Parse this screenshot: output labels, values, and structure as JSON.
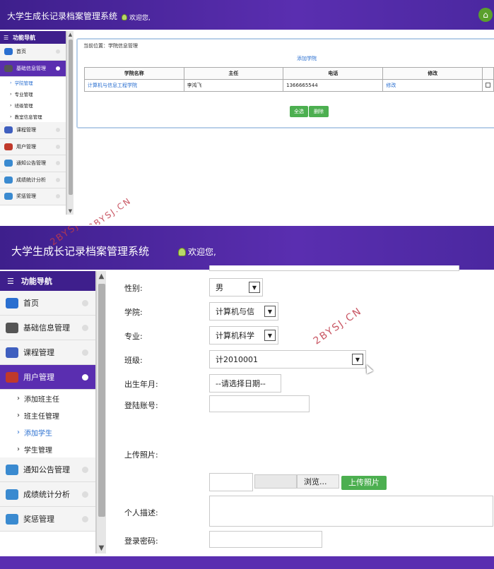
{
  "app": {
    "title": "大学生成长记录档案管理系统",
    "welcome": "欢迎您,",
    "nav_header": "功能导航"
  },
  "top": {
    "nav": [
      {
        "label": "首页",
        "icon": "monitor-icon",
        "color": "#2a6fd0"
      },
      {
        "label": "基础信息管理",
        "icon": "printer-icon",
        "color": "#555555",
        "active": true
      },
      {
        "label": "课程管理",
        "icon": "globe-icon",
        "color": "#3f5fbf"
      },
      {
        "label": "用户管理",
        "icon": "pdf-icon",
        "color": "#c0392b"
      },
      {
        "label": "通知公告管理",
        "icon": "gears-icon",
        "color": "#3a8ad0"
      },
      {
        "label": "成绩统计分析",
        "icon": "gears-icon",
        "color": "#3a8ad0"
      },
      {
        "label": "奖惩管理",
        "icon": "gears-icon",
        "color": "#3a8ad0"
      }
    ],
    "sub_items": [
      {
        "label": "学院管理",
        "current": true
      },
      {
        "label": "专业管理"
      },
      {
        "label": "班级管理"
      },
      {
        "label": "教室信息管理"
      }
    ],
    "breadcrumb": "当前位置：学院信息管理",
    "add_link": "添加学院",
    "table": {
      "headers": [
        "学院名称",
        "主任",
        "电话",
        "修改",
        ""
      ],
      "rows": [
        {
          "name": "计算机与信息工程学院",
          "director": "李鸿飞",
          "phone": "1366665544",
          "edit": "修改"
        }
      ]
    },
    "select_all": "全选",
    "delete": "删除"
  },
  "bottom": {
    "nav": [
      {
        "label": "首页",
        "icon": "monitor-icon",
        "color": "#2a6fd0"
      },
      {
        "label": "基础信息管理",
        "icon": "printer-icon",
        "color": "#555555"
      },
      {
        "label": "课程管理",
        "icon": "globe-icon",
        "color": "#3f5fbf"
      },
      {
        "label": "用户管理",
        "icon": "pdf-icon",
        "color": "#c0392b",
        "active": true
      }
    ],
    "sub_items": [
      {
        "label": "添加班主任"
      },
      {
        "label": "班主任管理"
      },
      {
        "label": "添加学生",
        "current": true
      },
      {
        "label": "学生管理"
      }
    ],
    "nav_after": [
      {
        "label": "通知公告管理",
        "icon": "gears-icon",
        "color": "#3a8ad0"
      },
      {
        "label": "成绩统计分析",
        "icon": "gears-icon",
        "color": "#3a8ad0"
      },
      {
        "label": "奖惩管理",
        "icon": "gears-icon",
        "color": "#3a8ad0"
      }
    ],
    "form": {
      "gender_label": "性别:",
      "gender_value": "男",
      "college_label": "学院:",
      "college_value": "计算机与信",
      "major_label": "专业:",
      "major_value": "计算机科学",
      "class_label": "班级:",
      "class_value": "计2010001",
      "birth_label": "出生年月:",
      "birth_value": "--请选择日期--",
      "account_label": "登陆账号:",
      "photo_label": "上传照片:",
      "browse_label": "浏览...",
      "upload_label": "上传照片",
      "desc_label": "个人描述:",
      "password_label": "登录密码:"
    }
  },
  "watermark": "2BYSJ.CN"
}
